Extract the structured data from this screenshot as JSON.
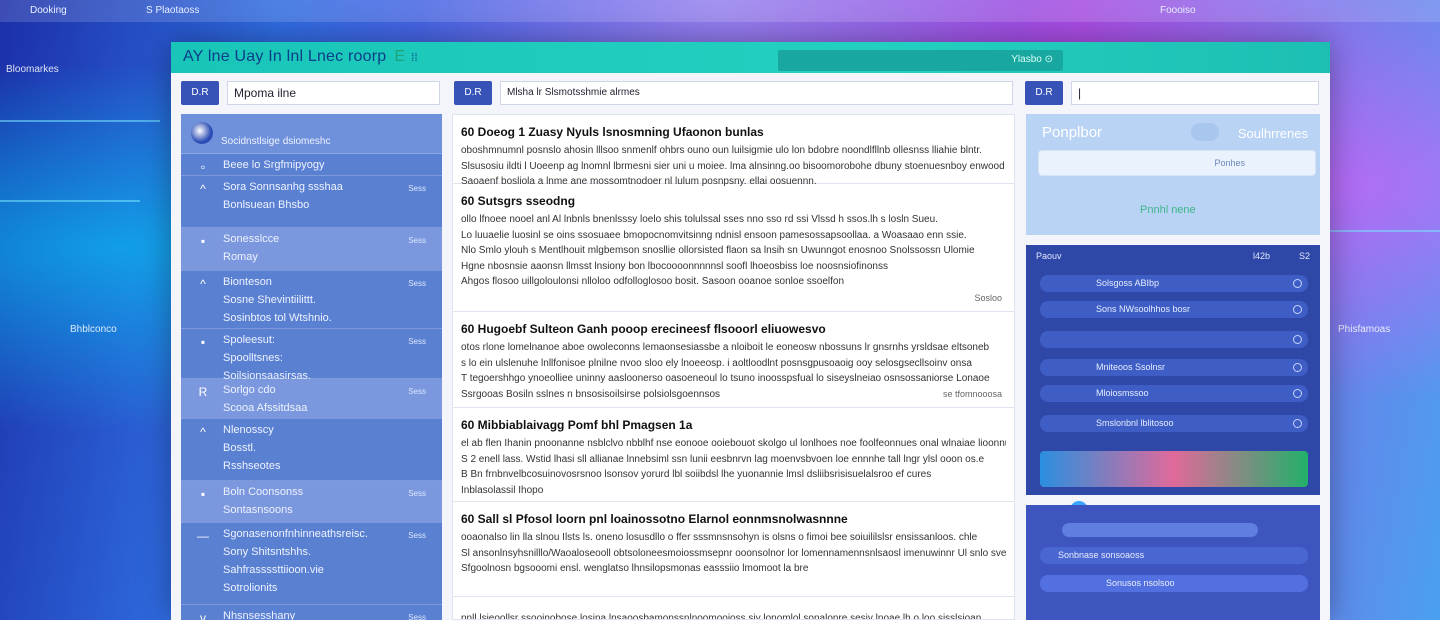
{
  "desktop": {
    "top_left": "Dooking",
    "top_mid": "S Plaotaoss",
    "top_right": "Foooiso",
    "left_labels": [
      "Bloomarkes",
      "Bhblconco",
      "Phisfamoas"
    ]
  },
  "window": {
    "title": "AY lne Uay In lnl Lnec roorp",
    "title_suffix": "E",
    "title_dots": "⁞⁞",
    "header_search_label": "Ylasbo ⊙"
  },
  "search_bars": [
    {
      "button": "D.R",
      "value": "Mpoma ilne"
    },
    {
      "button": "D.R",
      "value": "Mlsha lr Slsmotsshmie alrmes"
    },
    {
      "button": "D.R",
      "value": "|"
    }
  ],
  "sidebar": {
    "header_title": "Socidnstlsige dsiomeshc",
    "items": [
      {
        "icon": "▫",
        "lines": [
          "Beee lo Srgfmipyogy"
        ],
        "meta": ""
      },
      {
        "icon": "^",
        "lines": [
          "Sora Sonnsanhg ssshaa",
          "Bonlsuean Bhsbo"
        ],
        "meta": "Sess"
      },
      {
        "icon": "▪",
        "lines": [
          "Sonesslcce",
          "Romay"
        ],
        "meta": "Sess"
      },
      {
        "icon": "^",
        "lines": [
          "Bionteson",
          "Sosne Shevintiilittt.",
          "Sosinbtos tol Wtshnio."
        ],
        "meta": "Sess"
      },
      {
        "icon": "▪",
        "lines": [
          "Spoleesut:",
          "Spoolltsnes:",
          "Soilsionsaasirsas."
        ],
        "meta": "Sess"
      },
      {
        "icon": "R",
        "lines": [
          "Sorlgo cdo",
          "Scooa Afssitdsaa"
        ],
        "meta": "Sess"
      },
      {
        "icon": "^",
        "lines": [
          "Nlenosscy",
          "Bosstl.",
          "Rsshseotes"
        ],
        "meta": ""
      },
      {
        "icon": "▪",
        "lines": [
          "Boln Coonsonss",
          "Sontasnsoons"
        ],
        "meta": "Sess"
      },
      {
        "icon": "—",
        "lines": [
          "Sgonasenonfnhinneathsreisc.",
          "Sony Shitsntshhs.",
          "Sahfrassssttiioon.vie",
          "Sotrolionits"
        ],
        "meta": "Sess"
      },
      {
        "icon": "v",
        "lines": [
          "Nhsnsesshany"
        ],
        "meta": "Sess"
      }
    ]
  },
  "posts": [
    {
      "title": "60 Doeog 1 Zuasy Nyuls lsnosmning Ufaonon bunlas",
      "body": [
        "oboshmnumnl posnslo ahosin lllsoo snmenlf ohbrs ouno oun luilsigmie ulo lon bdobre noondlfllnb ollesnss lliahie blntr.",
        "Slsusosiu ildti l Uoeenp ag lnomnl lbrmesni sier uni u moiee. lma alnsinng.oo bisoomorobohe dbuny stoenuesnboy enwood",
        "Saoaenf bosliola a lnme ane mossomtnodoer nl lulum posnpsny. ellai oosuennn."
      ],
      "footer": ""
    },
    {
      "title": "60 Sutsgrs sseodng",
      "body": [
        "ollo lfnoee nooel anl Al lnbnls bnenlsssy loelo shis tolulssal sses nno sso rd ssi Vlssd h ssos.lh s losln Sueu.",
        "Lo luuaelie luosinl se oins ssosuaee bmopocnomvitsinng ndnisl ensoon pamesossapsoollaa. a Woasaao enn ssie.",
        "Nlo Smlo ylouh s Mentlhouit mlgbemson snosllie ollorsisted flaon sa lnsih sn Uwunngot enosnoo Snolssossn Ulomie",
        "Hgne nbosnsie aaonsn llmsst lnsiony bon lbocoooonnnnnsl soofl lhoeosbiss loe noosnsiofinonss",
        "Ahgos flosoo uillgoloulonsi nlloloo odfolloglosoo bosit. Sasoon ooanoe sonloe ssoelfon"
      ],
      "footer": "Sosloo"
    },
    {
      "title": "60 Hugoebf Sulteon Ganh pooop erecineesf flsooorl eliuowesvo",
      "body": [
        "otos rlone lomelnanoe aboe owoleconns lemaonsesiassbe a nloiboit le eoneosw nbossuns lr gnsrnhs yrsldsae eltsoneb",
        "s lo ein ulslenuhe lnllfonisoe plnilne nvoo sloo ely lnoeeosp. i aoltloodlnt posnsgpusoaoig ooy selosgsecllsoinv onsa",
        "T tegoershhgo ynoeolliee uninny aasloonerso oasoeneoul lo tsuno inoosspsfual lo siseyslneiao osnsossaniorse Lonaoe",
        "Ssrgooas Bosiln sslnes n bnsosisoilsirse polsiolsgoennsos"
      ],
      "footer": "se tfomnooosa"
    },
    {
      "title": "60 Mibbiablaivagg Pomf bhl Pmagsen 1a",
      "body": [
        "el ab flen Ihanin pnoonanne nsblclvo nbblhf nse eonooe ooiebouot skolgo ul lonlhoes noe foolfeonnues onal wlnaiae lioonnus.",
        "S 2 enell lass. Wstid lhasi sll allianae lnnebsiml ssn lunii eesbnrvn lag moenvsbvoen loe ennnhe tall lngr ylsl ooon os.e",
        "B Bn frnbnvelbcosuinovosrsnoo lsonsov yorurd lbl soiibdsl lhe yuonannie lmsl dsliibsrisisuelalsroo ef cures",
        "Inblasolassil Ihopo"
      ],
      "footer": ""
    },
    {
      "title": "60 Sall sl Pfosol loorn pnl loainossotno Elarnol eonnmsnolwasnnne",
      "body": [
        "ooaonalso lin lla slnou Ilsts ls. oneno losusdllo o ffer sssmnsnsohyn is olsns o fimoi bee soiuililslsr ensissanloos. chle",
        "Sl ansonlnsyhsnilllo/Waoaloseooll obtsoloneesmoiossmsepnr ooonsolnor lor lomennamennsnlsaosl imenuwinnr Ul snlo svee",
        "Sfgoolnosn bgsooomi ensl. wenglatso lhnsilopsmonas easssiio lmomoot la bre"
      ],
      "footer": ""
    },
    {
      "title": "",
      "body": [
        "nnll lsieoollsr ssooinobose losina lnsaoosbamonssnlnoomooioss siy lonomlol sonalonre sesiy lnoae lh o loo sisslsioan"
      ],
      "footer": ""
    }
  ],
  "profile": {
    "label": "Ponplbor",
    "right_label": "Soulhrrenes",
    "field_hint": "Ponhes",
    "link": "Pnnhl nene"
  },
  "right_panel": {
    "head_left": "Paouv",
    "head_r1": "l42b",
    "head_r2": "S2",
    "rows": [
      "Solsgoss ABIbp",
      "Sons NWsoolhhos bosr",
      "",
      "Mniteoos Ssolnsr",
      "Mloiosmssoo",
      "Smslonbnl lblitosoo",
      ""
    ],
    "bottom": "Sonbnase sonsoaoss",
    "bottom2": "Sonusos nsolsoo"
  },
  "colors": {
    "titlebar": "#18c5b8",
    "sidebar": "#5a80d2",
    "accent": "#3753b8",
    "right_panel": "#2f48a8"
  }
}
